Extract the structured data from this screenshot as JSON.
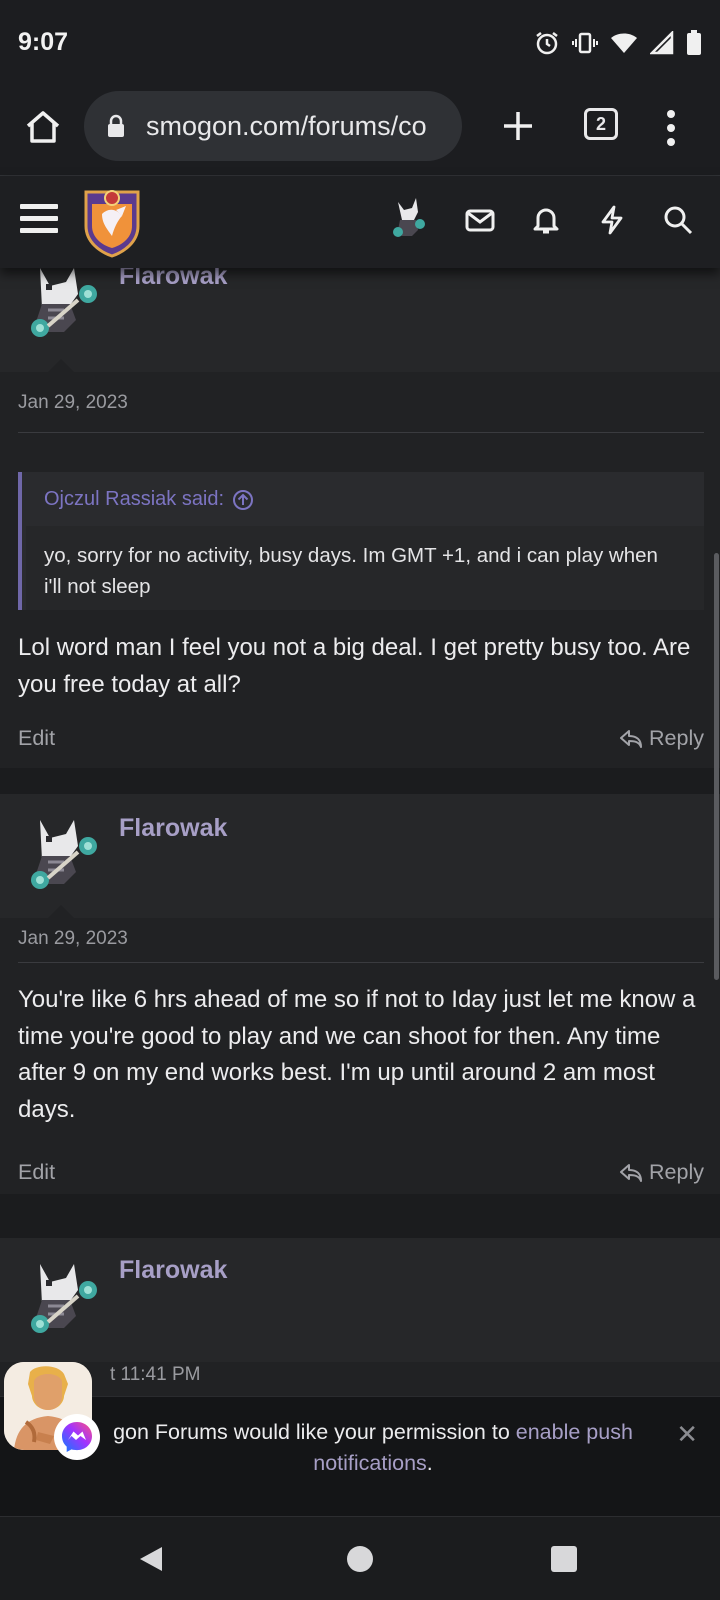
{
  "status_bar": {
    "time": "9:07",
    "icons": [
      "alarm-icon",
      "vibrate-icon",
      "wifi-icon",
      "signal-icon",
      "battery-icon"
    ]
  },
  "browser": {
    "url": "smogon.com/forums/co",
    "tab_count": "2"
  },
  "forum_header": {
    "icons": [
      "menu-icon",
      "site-logo",
      "user-avatar",
      "mail-icon",
      "bell-icon",
      "lightning-icon",
      "search-icon"
    ]
  },
  "posts": [
    {
      "username": "Flarowak",
      "date": "Jan 29, 2023",
      "quote": {
        "author": "Ojczul Rassiak said:",
        "text": "yo, sorry for no activity, busy days. Im GMT +1, and i can play when i'll not sleep"
      },
      "body": "Lol word man I feel you not a big deal. I get pretty busy too. Are you free today at all?",
      "edit_label": "Edit",
      "reply_label": "Reply"
    },
    {
      "username": "Flarowak",
      "date": "Jan 29, 2023",
      "body": "You're like 6 hrs ahead of me so if not to Iday just let me know a time you're good to play and we can shoot for then. Any time after 9 on my end works best. I'm up until around 2 am most days.",
      "edit_label": "Edit",
      "reply_label": "Reply"
    },
    {
      "username": "Flarowak",
      "date_partial": "t 11:41 PM"
    }
  ],
  "notification": {
    "text_before": "gon Forums would like your permission to ",
    "link_text": "enable push notifications",
    "text_after": ".",
    "close_label": "✕"
  },
  "colors": {
    "accent": "#a79fc6",
    "quote_accent": "#7c74c2",
    "background": "#1d1e20"
  }
}
